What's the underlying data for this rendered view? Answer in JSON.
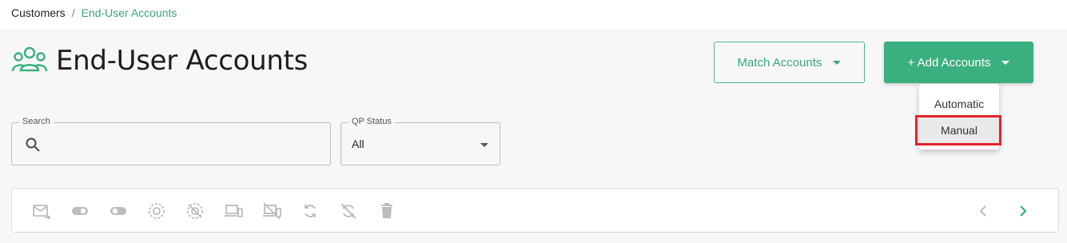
{
  "breadcrumb": {
    "root": "Customers",
    "separator": "/",
    "current": "End-User Accounts"
  },
  "page": {
    "title": "End-User Accounts",
    "title_icon": "users-group-icon"
  },
  "buttons": {
    "match_accounts": "Match Accounts",
    "add_accounts": "+ Add Accounts"
  },
  "add_menu": {
    "items": [
      "Automatic",
      "Manual"
    ],
    "highlighted": "Manual"
  },
  "filters": {
    "search_label": "Search",
    "search_value": "",
    "status_label": "QP Status",
    "status_value": "All"
  },
  "toolbar": {
    "icons": [
      "mail-forward-icon",
      "toggle-on-icon",
      "toggle-off-icon",
      "activate-icon",
      "deactivate-icon",
      "devices-icon",
      "devices-off-icon",
      "sync-icon",
      "sync-disabled-icon",
      "delete-icon"
    ],
    "pagination": [
      "chevron-left-icon",
      "chevron-right-icon"
    ]
  },
  "colors": {
    "accent": "#3bb07f",
    "accent_text": "#3ba77a",
    "highlight": "#e3232b",
    "disabled_icon": "#bcbcbc"
  }
}
